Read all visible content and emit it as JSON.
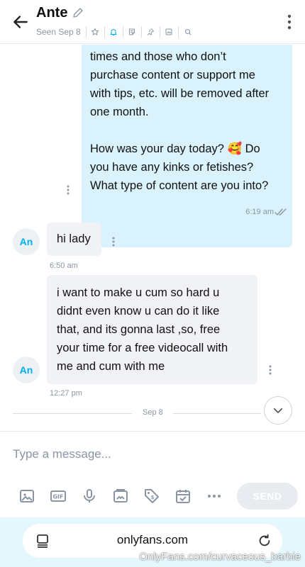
{
  "header": {
    "contact_name": "Ante",
    "seen": "Seen Sep 8"
  },
  "messages": {
    "outgoing": {
      "lines_1": [
        "times and those who don’t",
        "purchase content or support me",
        "with tips, etc. will be removed after",
        "one month."
      ],
      "lines_2": [
        "How was your day today? 🥰 Do",
        "you have any kinks or fetishes?",
        "What type of content are you into?"
      ],
      "line_1": "times and those who don’t",
      "line_2": "purchase content or support me",
      "line_3": "with tips, etc. will be removed after",
      "line_4": "one month.",
      "line_5": "How was your day today? 🥰 Do",
      "line_6": "you have any kinks or fetishes?",
      "line_7": "What type of content are you into?",
      "time": "6:19 am"
    },
    "incoming_1": {
      "avatar": "An",
      "text": "hi lady",
      "time": "6:50 am"
    },
    "incoming_2": {
      "avatar": "An",
      "line_1": "i want to make u cum so hard u",
      "line_2": "didnt even know u can do it like",
      "line_3": "that, and its gonna last ,so, free",
      "line_4": "your time for a free videocall with",
      "line_5": "me and cum with me",
      "time": "12:27 pm"
    },
    "date_divider": "Sep 8"
  },
  "composer": {
    "placeholder": "Type a message...",
    "send_label": "SEND"
  },
  "browser": {
    "url": "onlyfans.com"
  },
  "watermark": "OnlyFans.com/curvaceous_barbie",
  "colors": {
    "accent": "#00aff0",
    "outgoing_bubble": "#d9f2fb",
    "incoming_bubble": "#f0f2f5",
    "muted_text": "#8a96a3",
    "browser_bg": "#e4f7fd"
  }
}
